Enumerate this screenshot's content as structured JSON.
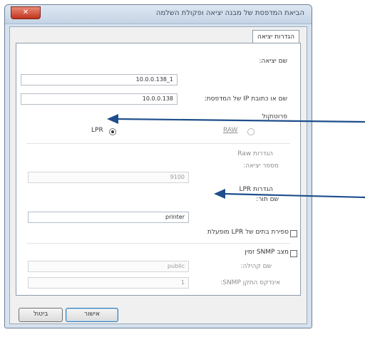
{
  "window": {
    "title": "הביאת המדפסת של מבנה יציאה ופקולת השלמה",
    "close_label": "✕"
  },
  "tab": {
    "label": "הגדרות יציאה"
  },
  "port": {
    "name_label": "שם יציאה:",
    "name_value": "10.0.0.138_1",
    "address_label": "שם או כתובת IP של המדפסת:",
    "address_value": "10.0.0.138",
    "protocol_label": "פרוטוקול",
    "raw_label": "RAW",
    "lpr_label": "LPR"
  },
  "raw_settings": {
    "header": "הגדרות Raw",
    "port_number_label": "מספר יציאה:",
    "port_number_value": "9100"
  },
  "lpr_settings": {
    "header": "הגדרות LPR",
    "queue_label": "שם תור:",
    "queue_value": "printer",
    "byte_count_label": "ספירת בתים של LPR מופעלת"
  },
  "snmp": {
    "enabled_label": "מצב SNMP זמין",
    "community_label": "שם קהילה:",
    "community_value": "public",
    "device_index_label": "אינדקס התקן SNMP:",
    "device_index_value": "1"
  },
  "buttons": {
    "ok_label": "אישור",
    "cancel_label": "ביטול"
  },
  "colors": {
    "arrow": "#1f4e8c"
  }
}
